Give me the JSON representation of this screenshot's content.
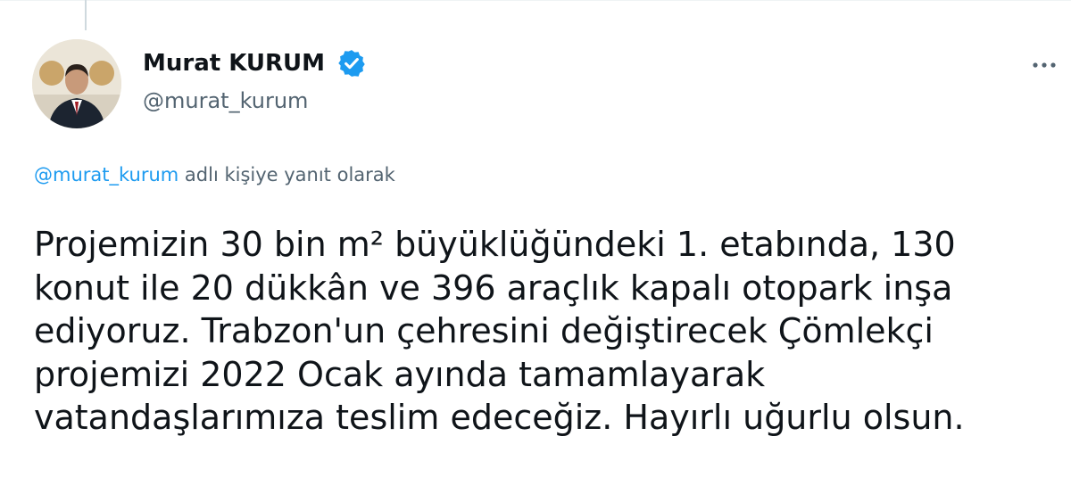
{
  "author": {
    "name": "Murat KURUM",
    "handle": "@murat_kurum",
    "verified": true
  },
  "reply_context": {
    "mention": "@murat_kurum",
    "text": " adlı kişiye yanıt olarak"
  },
  "tweet": {
    "text": "Projemizin 30 bin m² büyüklüğündeki 1. etabında, 130\nkonut ile 20 dükkân ve 396 araçlık kapalı otopark inşa\nediyoruz. Trabzon'un çehresini değiştirecek Çömlekçi\nprojemizi 2022 Ocak ayında tamamlayarak\nvatandaşlarımıza teslim edeceğiz. Hayırlı uğurlu olsun."
  },
  "icons": {
    "verified": "verified-badge-icon",
    "more": "more-options-icon"
  },
  "colors": {
    "accent": "#1d9bf0",
    "text": "#0f1419",
    "secondary_text": "#536471"
  }
}
